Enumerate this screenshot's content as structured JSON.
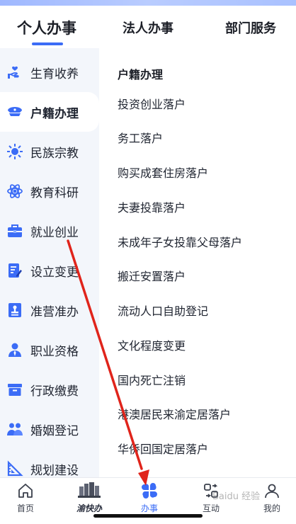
{
  "top_tabs": [
    {
      "label": "个人办事"
    },
    {
      "label": "法人办事"
    },
    {
      "label": "部门服务"
    }
  ],
  "sidebar": {
    "items": [
      {
        "label": "生育收养",
        "icon": "hand-heart-icon"
      },
      {
        "label": "户籍办理",
        "icon": "police-cap-icon"
      },
      {
        "label": "民族宗教",
        "icon": "sun-emblem-icon"
      },
      {
        "label": "教育科研",
        "icon": "atom-icon"
      },
      {
        "label": "就业创业",
        "icon": "briefcase-icon"
      },
      {
        "label": "设立变更",
        "icon": "edit-document-icon"
      },
      {
        "label": "准营准办",
        "icon": "stamp-icon"
      },
      {
        "label": "职业资格",
        "icon": "person-badge-icon"
      },
      {
        "label": "行政缴费",
        "icon": "archive-box-icon"
      },
      {
        "label": "婚姻登记",
        "icon": "couple-icon"
      },
      {
        "label": "规划建设",
        "icon": "ruler-icon"
      }
    ],
    "active_index": 1
  },
  "main": {
    "section_title": "户籍办理",
    "items": [
      "投资创业落户",
      "务工落户",
      "购买成套住房落户",
      "夫妻投靠落户",
      "未成年子女投靠父母落户",
      "搬迁安置落户",
      "流动人口自助登记",
      "文化程度变更",
      "国内死亡注销",
      "港澳居民来渝定居落户",
      "华侨回国定居落户"
    ]
  },
  "bottom_nav": {
    "items": [
      {
        "label": "首页",
        "icon": "home-icon"
      },
      {
        "label": "",
        "icon": "yukuaiban-logo-icon",
        "logo_text": "渝快办"
      },
      {
        "label": "办事",
        "icon": "grid-clover-icon"
      },
      {
        "label": "互动",
        "icon": "interaction-icon"
      },
      {
        "label": "我的",
        "icon": "user-icon"
      }
    ],
    "active_index": 2
  },
  "colors": {
    "accent": "#3b6cf6",
    "sidebar_bg": "#f3f6fb",
    "annotation_arrow": "#e0241b"
  },
  "watermark": "Baidu 经验"
}
